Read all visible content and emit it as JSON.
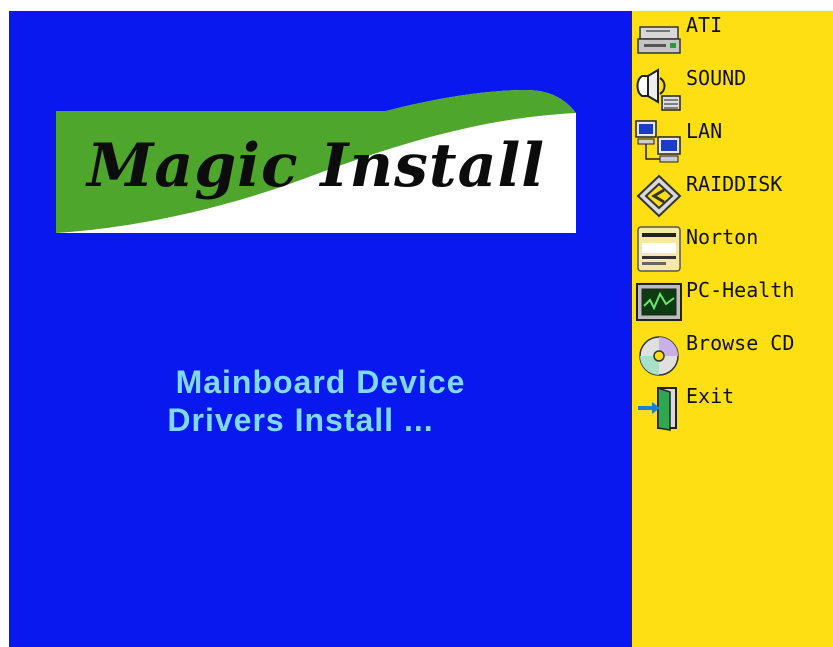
{
  "logo": {
    "text": "Magic Install",
    "colors": {
      "green": "#4fa62c",
      "white": "#ffffff",
      "ink": "#0c0c0c"
    }
  },
  "headline": {
    "line1": "Mainboard Device",
    "line2": "Drivers Install ..."
  },
  "colors": {
    "main_bg": "#0a18f0",
    "side_bg": "#fedf14",
    "headline": "#7fd9f4"
  },
  "menu": {
    "items": [
      {
        "label": "ATI",
        "icon": "drive-icon"
      },
      {
        "label": "SOUND",
        "icon": "sound-icon"
      },
      {
        "label": "LAN",
        "icon": "network-computers-icon"
      },
      {
        "label": "RAIDDISK",
        "icon": "raid-icon"
      },
      {
        "label": "Norton",
        "icon": "norton-icon"
      },
      {
        "label": "PC-Health",
        "icon": "monitor-graph-icon"
      },
      {
        "label": "Browse CD",
        "icon": "cd-icon"
      },
      {
        "label": "Exit",
        "icon": "exit-door-icon"
      }
    ]
  }
}
